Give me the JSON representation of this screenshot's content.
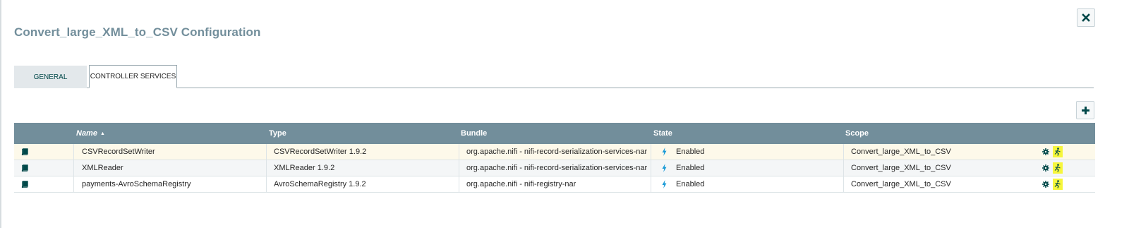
{
  "dialog": {
    "title": "Convert_large_XML_to_CSV Configuration",
    "close_icon": "close-icon"
  },
  "tabs": [
    {
      "label": "GENERAL",
      "active": false
    },
    {
      "label": "CONTROLLER SERVICES",
      "active": true
    }
  ],
  "toolbar": {
    "add_icon": "plus-icon"
  },
  "table": {
    "columns": [
      "Name",
      "Type",
      "Bundle",
      "State",
      "Scope"
    ],
    "sort": {
      "column": "Name",
      "direction": "ascending"
    },
    "rows": [
      {
        "name": "CSVRecordSetWriter",
        "type": "CSVRecordSetWriter 1.9.2",
        "bundle": "org.apache.nifi - nifi-record-serialization-services-nar",
        "state": "Enabled",
        "scope": "Convert_large_XML_to_CSV"
      },
      {
        "name": "XMLReader",
        "type": "XMLReader 1.9.2",
        "bundle": "org.apache.nifi - nifi-record-serialization-services-nar",
        "state": "Enabled",
        "scope": "Convert_large_XML_to_CSV"
      },
      {
        "name": "payments-AvroSchemaRegistry",
        "type": "AvroSchemaRegistry 1.9.2",
        "bundle": "org.apache.nifi - nifi-registry-nar",
        "state": "Enabled",
        "scope": "Convert_large_XML_to_CSV"
      }
    ]
  },
  "icons": {
    "row_info": "book-icon",
    "state": "lightning-bolt-icon",
    "configure": "gear-icon",
    "enable_disable": "enable-disable-icon"
  },
  "colors": {
    "header_bg": "#728e9b",
    "title_color": "#728e9b",
    "state_bolt": "#1a9bd7",
    "highlight": "#f6f63b",
    "row_selected": "#fdf9ea"
  }
}
